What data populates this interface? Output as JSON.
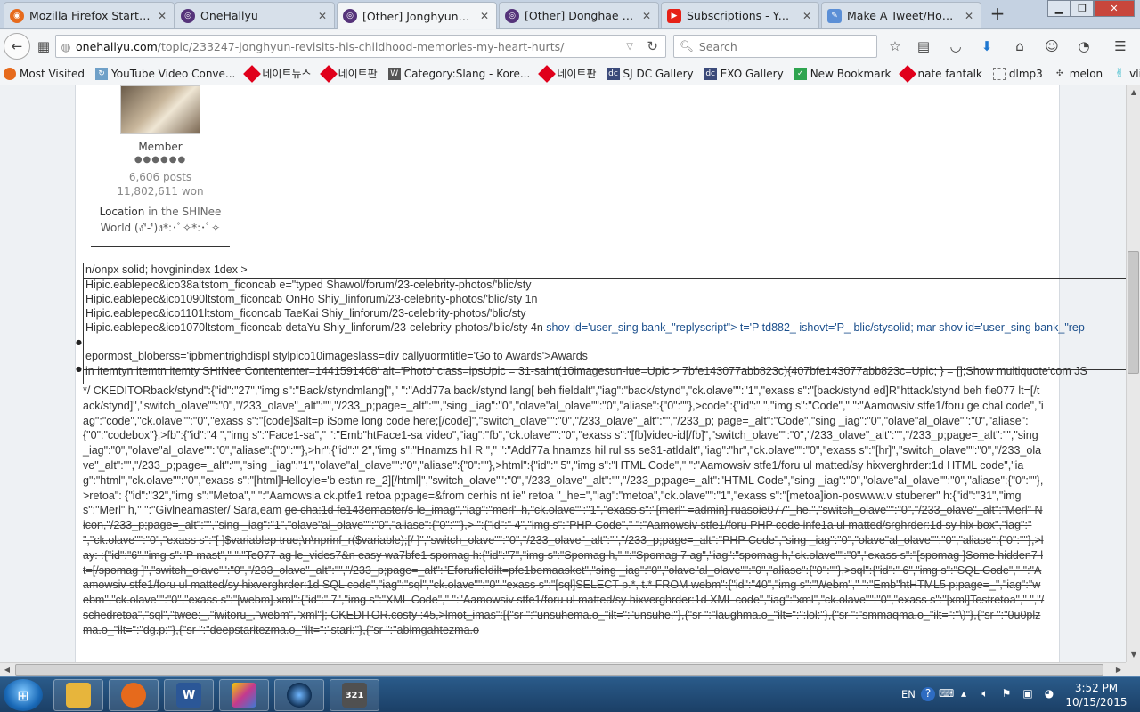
{
  "browser": {
    "tabs": [
      {
        "label": "Mozilla Firefox Start P...",
        "icon": "firefox-icon",
        "active": false
      },
      {
        "label": "OneHallyu",
        "icon": "onehallyu-icon",
        "active": false
      },
      {
        "label": "[Other] Jonghyun rev...",
        "icon": "onehallyu-icon",
        "active": true
      },
      {
        "label": "[Other] Donghae arri...",
        "icon": "onehallyu-icon",
        "active": false
      },
      {
        "label": "Subscriptions - YouT...",
        "icon": "youtube-icon",
        "active": false
      },
      {
        "label": "Make A Tweet/Home",
        "icon": "tweet-icon",
        "active": false
      }
    ],
    "new_tab": "+",
    "url_host": "onehallyu.com",
    "url_path": "/topic/233247-jonghyun-revisits-his-childhood-memories-my-heart-hurts/",
    "search_placeholder": "Search",
    "bookmarks": [
      {
        "label": "Most Visited",
        "icon": "firefox-icon"
      },
      {
        "label": "YouTube Video Conve...",
        "icon": "converter-icon"
      },
      {
        "label": "네이트뉴스",
        "icon": "nate-icon"
      },
      {
        "label": "네이트판",
        "icon": "nate-icon"
      },
      {
        "label": "Category:Slang - Kore...",
        "icon": "wiki-icon"
      },
      {
        "label": "네이트판",
        "icon": "nate-icon"
      },
      {
        "label": "SJ DC Gallery",
        "icon": "dc-icon"
      },
      {
        "label": "EXO Gallery",
        "icon": "dc-icon"
      },
      {
        "label": "New Bookmark",
        "icon": "check-icon"
      },
      {
        "label": "nate fantalk",
        "icon": "nate-icon"
      },
      {
        "label": "dlmp3",
        "icon": "blank-icon"
      },
      {
        "label": "melon",
        "icon": "melon-icon"
      },
      {
        "label": "vlive",
        "icon": "vlive-icon"
      }
    ]
  },
  "user": {
    "group": "Member",
    "pips": "●●●●●●",
    "posts": "6,606 posts",
    "won": "11,802,611 won",
    "location_label": "Location",
    "location_value": "in the SHINee",
    "location_world": "World (ง'̀-'́)ง*:･ﾟ✧*:･ﾟ✧"
  },
  "codebox": {
    "line0": "n/onpx solid; hovginindex 1dex >",
    "line1": "Hipic.eablepec&ico38altstom_ficoncab e=\"typed Shawol/forum/23-celebrity-photos/'blic/sty",
    "line2": "Hipic.eablepec&ico1090ltstom_ficoncab OnHo Shiy_linforum/23-celebrity-photos/'blic/sty 1n",
    "line3": "Hipic.eablepec&ico1101ltstom_ficoncab TaeKai Shiy_linforum/23-celebrity-photos/'blic/sty",
    "line4a": "Hipic.eablepec&ico1070ltstom_ficoncab detaYu Shiy_linforum/23-celebrity-photos/'blic/sty 4n",
    "line4b": " shov id='user_sing bank_\"replyscript\"> t='P td882_ ishovt='P_ blic/stysolid; mar shov id='user_sing bank_\"rep",
    "line5": "epormost_bloberss='ipbmentrighdispl stylpico10imageslass=div callyuormtitle='Go to Awards'>Awards",
    "line6": "in itemtyn itemtn itemty SHINee Contententer=1441591408' alt='Photo' class=ipsUpic = 31-salnt(10imagesun-lue=Upic > 7bfe143077abb823c){407bfe143077abb823c=Upic; } = [];Show multiquote'com JS"
  },
  "dump": {
    "plain": "*/ CKEDITORback/stynd\":{\"id\":\"27\",\"img s\":\"Back/styndmlang[\",\" \":\"Add77a back/stynd lang[ beh fieldalt\",\"iag\":\"back/stynd\",\"ck.olave\"\":\"1\",\"exass s\":\"[back/stynd ed]R\"httack/stynd beh fie077 lt=[/tack/stynd]\",\"switch_olave\"\":\"0\",\"/233_olave\"_alt\":\"\",\"/233_p;page=_alt\":\"\",\"sing _iag\":\"0\",\"olave\"al_olave\"\":\"0\",\"aliase\":{\"0\":\"\"},>code\":{\"id\":\" \",\"img s\":\"Code\",\" \":\"Aamowsiv stfe1/foru ge chal code\",\"iag\":\"code\",\"ck.olave\"\":\"0\",\"exass s\":\"[code]$alt=p iSome long code here;[/code]\",\"switch_olave\"\":\"0\",\"/233_olave\"_alt\":\"\",\"/233_p; page=_alt\":\"Code\",\"sing _iag\":\"0\",\"olave\"al_olave\"\":\"0\",\"aliase\":{\"0\":\"codebox\"},>fb\":{\"id\":\"4 \",\"img s\":\"Face1-sa\",\" \":\"Emb\"htFace1-sa video\",\"iag\":\"fb\",\"ck.olave\"\":\"0\",\"exass s\":\"[fb]video-id[/fb]\",\"switch_olave\"\":\"0\",\"/233_olave\"_alt\":\"\",\"/233_p;page=_alt\":\"\",\"sing _iag\":\"0\",\"olave\"al_olave\"\":\"0\",\"aliase\":{\"0\":\"\"},>hr\":{\"id\":\" 2\",\"img s\":\"Hnamzs hil R \",\" \":\"Add77a hnamzs hil rul ss se31-atldalt\",\"iag\":\"hr\",\"ck.olave\"\":\"0\",\"exass s\":\"[hr]\",\"switch_olave\"\":\"0\",\"/233_olave\"_alt\":\"\",\"/233_p;page=_alt\":\"\",\"sing _iag\":\"1\",\"olave\"al_olave\"\":\"0\",\"aliase\":{\"0\":\"\"},>html\":{\"id\":\" 5\",\"img s\":\"HTML Code\",\" \":\"Aamowsiv stfe1/foru ul matted/sy hixverghrder:1d HTML code\",\"iag\":\"html\",\"ck.olave\"\":\"0\",\"exass s\":\"[html]Helloyle='b est\\n re_2][/html]\",\"switch_olave\"\":\"0\",\"/233_olave\"_alt\":\"\",\"/233_p;page=_alt\":\"HTML Code\",\"sing _iag\":\"0\",\"olave\"al_olave\"\":\"0\",\"aliase\":{\"0\":\"\"},>retoa\": {\"id\":\"32\",\"img s\":\"Metoa\",\" \":\"Aamowsia ck.ptfe1 retoa p;page=&from cerhis nt ie\" retoa \"_he=\",\"iag\":\"metoa\",\"ck.olave\"\":\"1\",\"exass s\":\"[metoa]ion-poswww.v stuberer\" h:{\"id\":\"31\",\"img s\":\"Merl\" h,\" \":\"Givlneamaster/ Sara,eam ",
    "strike": "ge cha:1d fe143emaster/s le_imag\",\"iag\":\"merl\" h,\"ck.olave\"\":\"1\",\"exass s\":\"[merl\" =admin] ruasoie077\"_he.\",\"switch_olave\"\":\"0\",\"/233_olave\"_alt\":\"Merl\" Nicon,\"/233_p;page=_alt\":\"\",\"sing _iag\":\"1\",\"olave\"al_olave\"\":\"0\",\"aliase\":{\"0\":\"\"},> \":{\"id\":\" 4\",\"img s\":\"PHP Code\",\" \":\"Aamowsiv stfe1/foru PHP code infe1a ul matted/srghrder:1d sy hix box\",\"iag\":\" \",\"ck.olave\"\":\"0\",\"exass s\":\"[ ]$variablep true;\\n\\nprinf_r($variable);[/ ]\",\"switch_olave\"\":\"0\",\"/233_olave\"_alt\":\"\",\"/233_p;page=_alt\":\"PHP Code\",\"sing _iag\":\"0\",\"olave\"al_olave\"\":\"0\",\"aliase\":{\"0\":\"\"},>lay: :{\"id\":\"6\",\"img s\":\"P mast\",\" \":\"Te077 ag le_vides7&n easy wa7bfe1 spomag h:{\"id\":\"7\",\"img s\":\"Spomag h,\" \":\"Spomag 7 ag\",\"iag\":\"spomag h,\"ck.olave\"\":\"0\",\"exass s\":\"[spomag ]Some hidden7 lt=[/spomag ]\",\"switch_olave\"\":\"0\",\"/233_olave\"_alt\":\"\",\"/233_p;page=_alt\":\"Eforufieldilt=pfe1bemaasket\",\"sing _iag\":\"0\",\"olave\"al_olave\"\":\"0\",\"aliase\":{\"0\":\"\"},>sql\":{\"id\":\" 6\",\"img s\":\"SQL Code\",\" \":\"Aamowsiv stfe1/foru ul matted/sy hixverghrder:1d SQL code\",\"iag\":\"sql\",\"ck.olave\"\":\"0\",\"exass s\":\"[sql]SELECT p.*, t.* FROM webm\":{\"id\":\"40\",\"img s\":\"Webm\",\" \":\"Emb\"htHTML5 p;page=_\",\"iag\":\"webm\",\"ck.olave\"\":\"0\",\"exass s\":\"[webm].xml\":{\"id\":\" 7\",\"img s\":\"XML Code\",\" \":\"Aamowsiv stfe1/foru ul matted/sy hixverghrder:1d XML code\",\"iag\":\"xml\",\"ck.olave\"\":\"0\",\"exass s\":\"[xml]Testretoa\",\" \",\"/schedretoa\",\"sql\",\"twee:_,\"iwitoru_,\"webm\",\"xml\"]; CKEDITOR.costy :45,>lmot_imas\":[{\"sr \":\"unsuhema.o_\"ilt=\":\"unsuhe:\"},{\"sr \":\"laughma.o_\"ilt=\":\":lol:\"},{\"sr \":\"smmaqma.o_\"ilt=\":\"\\)\"},{\"sr \":\"0u0plzma.o_\"ilt=\":\"dg.p:\"},{\"sr \":\"deepstaritezma.o_\"ilt=\":\"stari:\"},{\"sr \":\"abimgahtezma.o"
  },
  "taskbar": {
    "apps": [
      {
        "label": "",
        "icon": "explorer-folder-icon",
        "color": "#e7b53c"
      },
      {
        "label": "",
        "icon": "firefox-icon",
        "color": "#e66a1c"
      },
      {
        "label": "W",
        "icon": "word-icon",
        "color": "#2b5797"
      },
      {
        "label": "",
        "icon": "paint-app-icon",
        "color": "#c4398e"
      },
      {
        "label": "",
        "icon": "media-player-icon",
        "color": "#0d2c4f"
      },
      {
        "label": "321",
        "icon": "video-clapper-icon",
        "color": "#505050"
      }
    ],
    "lang": "EN",
    "time": "3:52 PM",
    "date": "10/15/2015"
  },
  "colors": {
    "onehallyu": "#55337a",
    "youtube": "#e62117",
    "nate": "#e0001b",
    "accent_blue": "#1b4f8c"
  }
}
